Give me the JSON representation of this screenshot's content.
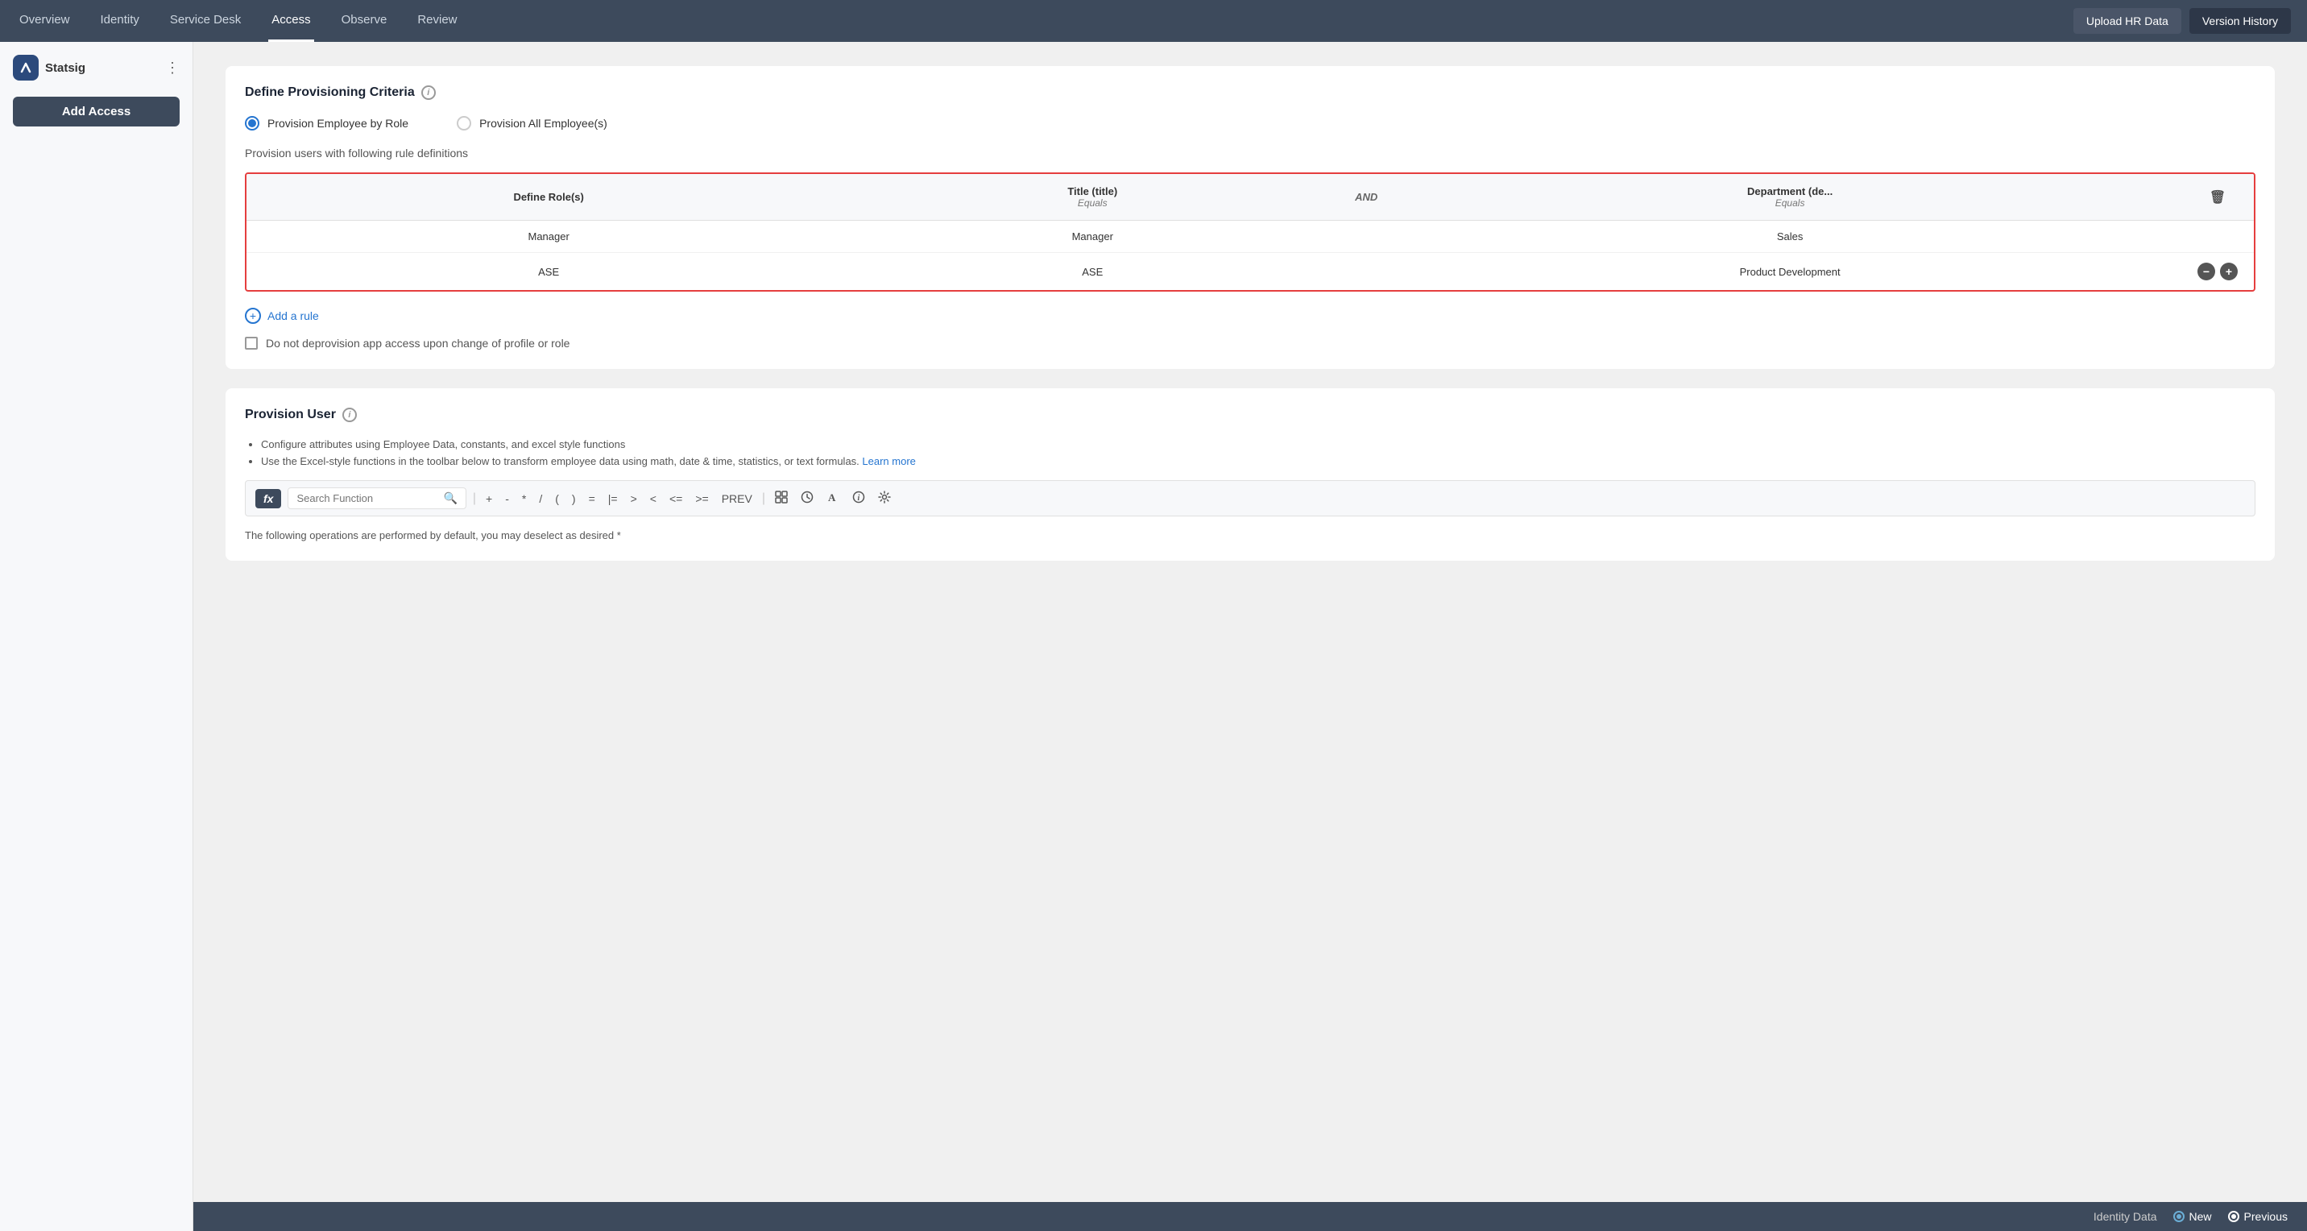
{
  "nav": {
    "links": [
      {
        "label": "Overview",
        "active": false
      },
      {
        "label": "Identity",
        "active": false
      },
      {
        "label": "Service Desk",
        "active": false
      },
      {
        "label": "Access",
        "active": true
      },
      {
        "label": "Observe",
        "active": false
      },
      {
        "label": "Review",
        "active": false
      }
    ],
    "buttons": [
      {
        "label": "Upload HR Data",
        "key": "upload-hr-data"
      },
      {
        "label": "Version History",
        "key": "version-history"
      }
    ]
  },
  "sidebar": {
    "app_name": "Statsig",
    "add_access_label": "Add Access"
  },
  "provisioning_criteria": {
    "title": "Define Provisioning Criteria",
    "radio_options": [
      {
        "label": "Provision Employee by Role",
        "selected": true
      },
      {
        "label": "Provision All Employee(s)",
        "selected": false
      }
    ],
    "rule_text": "Provision users with following rule definitions",
    "table": {
      "columns": [
        {
          "label": "Define Role(s)",
          "sub": ""
        },
        {
          "label": "Title (title)",
          "sub": "Equals"
        },
        {
          "connector": "AND"
        },
        {
          "label": "Department (de...",
          "sub": "Equals"
        },
        {
          "label": "",
          "sub": ""
        }
      ],
      "rows": [
        {
          "role": "Manager",
          "title": "Manager",
          "department": "Sales",
          "show_actions": false
        },
        {
          "role": "ASE",
          "title": "ASE",
          "department": "Product Development",
          "show_actions": true
        }
      ]
    },
    "add_rule_label": "Add a rule",
    "checkbox_label": "Do not deprovision app access upon change of profile or role"
  },
  "provision_user": {
    "title": "Provision User",
    "bullets": [
      {
        "text": "Configure attributes using Employee Data, constants, and excel style functions"
      },
      {
        "text": "Use the Excel-style functions in the toolbar below to transform employee data using math, date & time, statistics, or text formulas. ",
        "link": "Learn more"
      }
    ],
    "toolbar": {
      "fx_label": "fx",
      "search_placeholder": "Search Function",
      "operators": [
        "+",
        "-",
        "*",
        "/",
        "(",
        ")",
        "=",
        "|=",
        ">",
        "<",
        "<=",
        ">=",
        "PREV"
      ]
    }
  },
  "bottom_bar": {
    "operations_text": "The following operations are performed by default, you may deselect as desired *",
    "identity_data_label": "Identity Data",
    "new_label": "New",
    "previous_label": "Previous"
  }
}
